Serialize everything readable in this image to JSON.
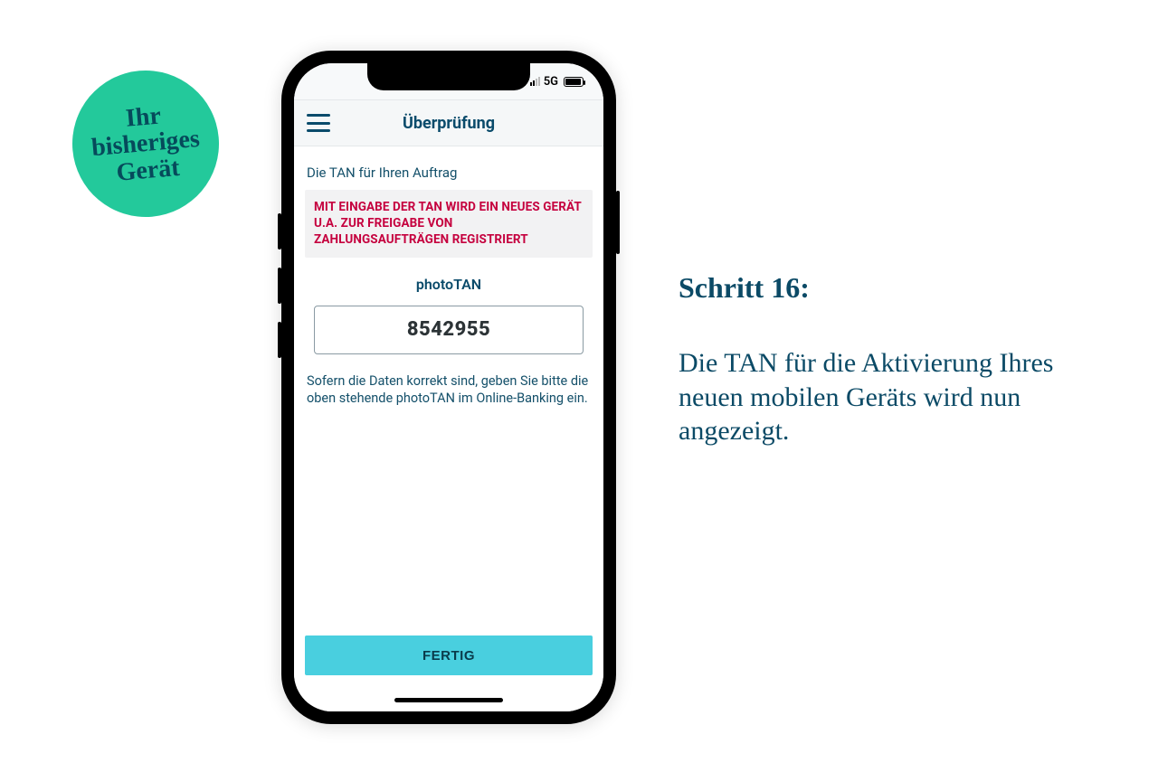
{
  "badge": {
    "line1": "Ihr",
    "line2": "bisheriges",
    "line3": "Gerät"
  },
  "statusbar": {
    "network": "5G"
  },
  "app": {
    "header_title": "Überprüfung",
    "subtitle": "Die TAN für Ihren Auftrag",
    "warning": "MIT EINGABE DER TAN WIRD EIN NEUES GERÄT U.A. ZUR FREIGABE VON ZAHLUNGSAUFTRÄGEN REGISTRIERT",
    "tan_label": "photoTAN",
    "tan_value": "8542955",
    "instruction": "Sofern die Daten korrekt sind, geben Sie bitte die oben stehende photoTAN im Online-Banking ein.",
    "done_label": "FERTIG"
  },
  "side": {
    "step_title": "Schritt 16:",
    "step_desc": "Die TAN für die Aktivierung Ihres neuen mobilen Geräts wird nun angezeigt."
  }
}
